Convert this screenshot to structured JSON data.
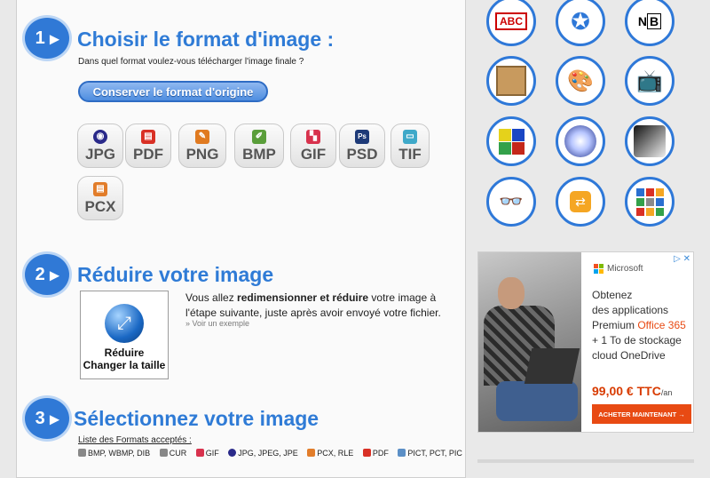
{
  "step1": {
    "number": "1",
    "title": "Choisir le format d'image :",
    "subtitle": "Dans quel format voulez-vous télécharger l'image finale ?",
    "keep_button": "Conserver le format d'origine",
    "formats": [
      {
        "label": "JPG",
        "icon": "jpg-icon",
        "color": "#2a2a8a"
      },
      {
        "label": "PDF",
        "icon": "pdf-icon",
        "color": "#d93025"
      },
      {
        "label": "PNG",
        "icon": "png-icon",
        "color": "#e07a20"
      },
      {
        "label": "BMP",
        "icon": "bmp-icon",
        "color": "#5a9e3a"
      },
      {
        "label": "GIF",
        "icon": "gif-icon",
        "color": "#d8324d"
      },
      {
        "label": "PSD",
        "icon": "psd-icon",
        "color": "#1d3a78"
      },
      {
        "label": "TIF",
        "icon": "tif-icon",
        "color": "#3fa9c9"
      },
      {
        "label": "PCX",
        "icon": "pcx-icon",
        "color": "#e27d2a"
      }
    ]
  },
  "step2": {
    "number": "2",
    "title": "Réduire votre image",
    "box_line1": "Réduire",
    "box_line2": "Changer la taille",
    "desc_pre": "Vous allez ",
    "desc_b1": "redimensionner et réduire",
    "desc_post": " votre image à l'étape suivante, juste après avoir envoyé votre fichier.",
    "example_link": "» Voir un exemple"
  },
  "step3": {
    "number": "3",
    "title": "Sélectionnez votre image",
    "formats_title": "Liste des Formats acceptés :",
    "accepted": [
      "BMP, WBMP, DIB",
      "CUR",
      "GIF",
      "JPG, JPEG, JPE",
      "PCX, RLE",
      "PDF",
      "PICT, PCT, PIC"
    ]
  },
  "tools": [
    {
      "icon": "abc-stamp-icon",
      "glyph": "ABC"
    },
    {
      "icon": "seal-icon",
      "glyph": "✪"
    },
    {
      "icon": "nb-icon",
      "glyph": "NB"
    },
    {
      "icon": "old-photo-icon",
      "glyph": "▣"
    },
    {
      "icon": "palette-icon",
      "glyph": "🎨"
    },
    {
      "icon": "tv-icon",
      "glyph": "📺"
    },
    {
      "icon": "pop-art-icon",
      "glyph": "▦"
    },
    {
      "icon": "sparkle-icon",
      "glyph": "✺"
    },
    {
      "icon": "bw-portrait-icon",
      "glyph": "◐"
    },
    {
      "icon": "3d-glasses-icon",
      "glyph": "👓"
    },
    {
      "icon": "convert-icon",
      "glyph": "⇄"
    },
    {
      "icon": "collage-icon",
      "glyph": "▤"
    }
  ],
  "ad": {
    "close_label": "▷ ✕",
    "brand": "Microsoft",
    "line1": "Obtenez",
    "line2": "des applications",
    "line3_pre": "Premium ",
    "line3_accent": "Office 365",
    "line4": "+ 1 To de stockage",
    "line5": "cloud OneDrive",
    "price": "99,00 € TTC",
    "price_unit": "/an",
    "cta": "ACHETER MAINTENANT →"
  }
}
